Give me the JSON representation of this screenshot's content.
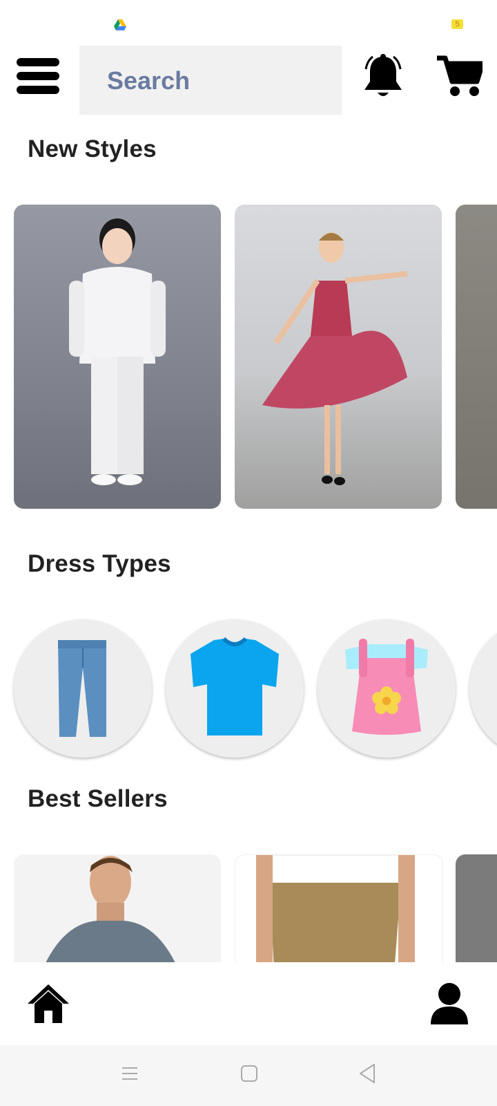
{
  "status_bar": {
    "battery_level": "5"
  },
  "header": {
    "search_placeholder": "Search"
  },
  "sections": {
    "new_styles": {
      "title": "New Styles"
    },
    "dress_types": {
      "title": "Dress Types",
      "items": [
        "jeans-icon",
        "tshirt-icon",
        "kids-dress-icon"
      ]
    },
    "best_sellers": {
      "title": "Best Sellers"
    }
  },
  "colors": {
    "accent_text": "#6a7ba0",
    "search_bg": "#f1f1f1",
    "circle_bg": "#eeeeee"
  }
}
